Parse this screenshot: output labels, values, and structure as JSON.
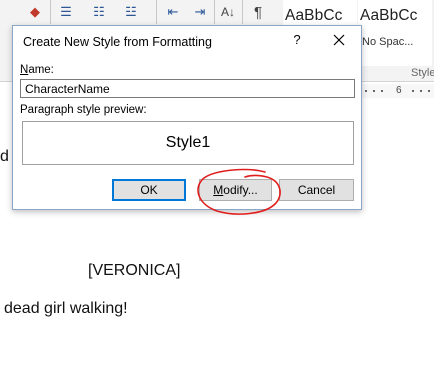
{
  "ribbon": {
    "tools": [
      {
        "icon": "eraser-icon",
        "glyph": "◆"
      },
      {
        "icon": "bullets-icon",
        "glyph": "☰"
      },
      {
        "icon": "numbering-icon",
        "glyph": "☷"
      },
      {
        "icon": "multilevel-list-icon",
        "glyph": "☳"
      },
      {
        "icon": "decrease-indent-icon",
        "glyph": "⇤"
      },
      {
        "icon": "increase-indent-icon",
        "glyph": "⇥"
      },
      {
        "icon": "sort-icon",
        "glyph": "A↓"
      },
      {
        "icon": "pilcrow-icon",
        "glyph": "¶"
      }
    ],
    "styles": [
      {
        "sample": "AaBbCc",
        "name": ""
      },
      {
        "sample": "AaBbCc",
        "name": "No Spac..."
      }
    ],
    "styles_group_label": "Style",
    "ruler_number": "6"
  },
  "document": {
    "line_fragment": "d",
    "character": "[VERONICA]",
    "dialogue": "dead girl walking!"
  },
  "dialog": {
    "title": "Create New Style from Formatting",
    "help_glyph": "?",
    "name_label_u": "N",
    "name_label_rest": "ame:",
    "name_value": "CharacterName",
    "preview_label": "Paragraph style preview:",
    "preview_text": "Style1",
    "ok_label": "OK",
    "modify_label_u": "M",
    "modify_label_rest": "odify...",
    "cancel_label": "Cancel",
    "annotation_color": "#e01e1e"
  }
}
